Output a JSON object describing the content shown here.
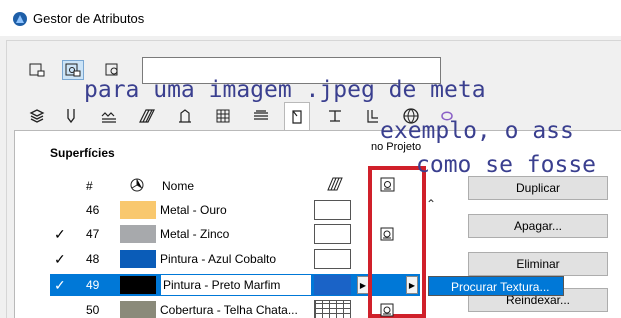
{
  "window": {
    "title": "Gestor de Atributos"
  },
  "search": {
    "value": ""
  },
  "overlay": {
    "line1": "para uma imagem .jpeg de meta",
    "line2": "exemplo, o ass",
    "line3": "como se fosse"
  },
  "section": {
    "title": "Superfícies"
  },
  "columns": {
    "num": "#",
    "name": "Nome",
    "in_project": "no Projeto"
  },
  "rows": [
    {
      "num": "46",
      "checked": false,
      "color": "#f9c86e",
      "name": "Metal - Ouro",
      "has_texture": false
    },
    {
      "num": "47",
      "checked": true,
      "color": "#a7a9ac",
      "name": "Metal - Zinco",
      "has_texture": true
    },
    {
      "num": "48",
      "checked": true,
      "color": "#0a5cb8",
      "name": "Pintura - Azul Cobalto",
      "has_texture": false
    },
    {
      "num": "49",
      "checked": true,
      "color": "#000000",
      "name": "Pintura - Preto Marfim",
      "has_texture": false,
      "selected": true
    },
    {
      "num": "50",
      "checked": false,
      "color": "#8a8a7a",
      "name": "Cobertura - Telha Chata...",
      "has_texture": true
    }
  ],
  "check_mark": "✓",
  "buttons": {
    "duplicate": "Duplicar",
    "delete": "Apagar...",
    "eliminate": "Eliminar",
    "reindex": "Reindexar..."
  },
  "context_menu": {
    "browse_texture": "Procurar Textura..."
  },
  "colors": {
    "accent": "#0078d7",
    "highlight_box": "#d0202a"
  }
}
